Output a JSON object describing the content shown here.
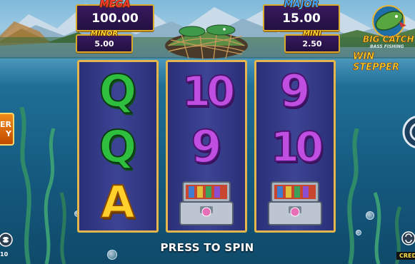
{
  "jackpots": {
    "mega": {
      "title": "MEGA",
      "value": "100.00"
    },
    "major": {
      "title": "MAJOR",
      "value": "15.00"
    },
    "minor": {
      "title": "MINOR",
      "value": "5.00"
    },
    "mini": {
      "title": "MINI",
      "value": "2.50"
    }
  },
  "logo": {
    "line1": "BIG CATCH",
    "line2": "BASS FISHING",
    "line3": "WIN STEPPER"
  },
  "reels": [
    [
      {
        "symbol": "Q",
        "style": "green"
      },
      {
        "symbol": "Q",
        "style": "green"
      },
      {
        "symbol": "A",
        "style": "gold"
      }
    ],
    [
      {
        "symbol": "10",
        "style": "purple"
      },
      {
        "symbol": "9",
        "style": "purple"
      },
      {
        "symbol": "tackle-box",
        "style": "box"
      }
    ],
    [
      {
        "symbol": "9",
        "style": "purple"
      },
      {
        "symbol": "10",
        "style": "purple"
      },
      {
        "symbol": "tackle-box",
        "style": "box"
      }
    ]
  ],
  "spin_prompt": "PRESS TO SPIN",
  "left_feature_button": {
    "line1": "ER",
    "line2": "Y"
  },
  "bet_value": "10",
  "credits_label": "CREDI"
}
